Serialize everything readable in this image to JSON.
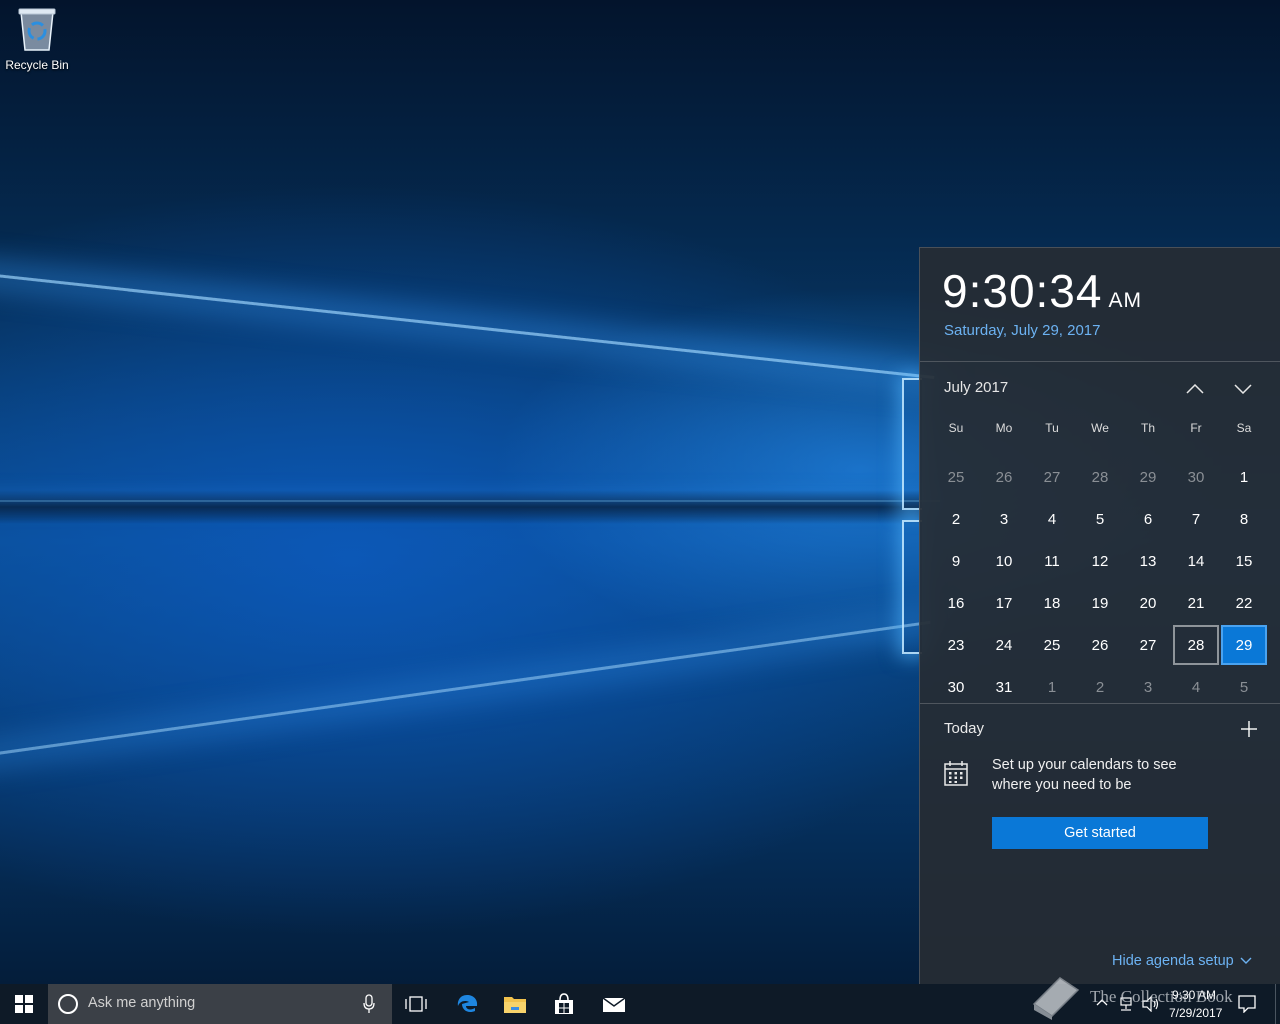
{
  "desktop": {
    "icons": [
      {
        "label": "Recycle Bin",
        "icon": "recycle-bin-icon"
      }
    ]
  },
  "flyout": {
    "time": "9:30:34",
    "ampm": "AM",
    "date": "Saturday, July 29, 2017",
    "month_title": "July 2017",
    "weekdays": [
      "Su",
      "Mo",
      "Tu",
      "We",
      "Th",
      "Fr",
      "Sa"
    ],
    "days": [
      {
        "n": "25",
        "other": true
      },
      {
        "n": "26",
        "other": true
      },
      {
        "n": "27",
        "other": true
      },
      {
        "n": "28",
        "other": true
      },
      {
        "n": "29",
        "other": true
      },
      {
        "n": "30",
        "other": true
      },
      {
        "n": "1"
      },
      {
        "n": "2"
      },
      {
        "n": "3"
      },
      {
        "n": "4"
      },
      {
        "n": "5"
      },
      {
        "n": "6"
      },
      {
        "n": "7"
      },
      {
        "n": "8"
      },
      {
        "n": "9"
      },
      {
        "n": "10"
      },
      {
        "n": "11"
      },
      {
        "n": "12"
      },
      {
        "n": "13"
      },
      {
        "n": "14"
      },
      {
        "n": "15"
      },
      {
        "n": "16"
      },
      {
        "n": "17"
      },
      {
        "n": "18"
      },
      {
        "n": "19"
      },
      {
        "n": "20"
      },
      {
        "n": "21"
      },
      {
        "n": "22"
      },
      {
        "n": "23"
      },
      {
        "n": "24"
      },
      {
        "n": "25"
      },
      {
        "n": "26"
      },
      {
        "n": "27"
      },
      {
        "n": "28",
        "selected": true
      },
      {
        "n": "29",
        "today": true
      },
      {
        "n": "30"
      },
      {
        "n": "31"
      },
      {
        "n": "1",
        "other": true
      },
      {
        "n": "2",
        "other": true
      },
      {
        "n": "3",
        "other": true
      },
      {
        "n": "4",
        "other": true
      },
      {
        "n": "5",
        "other": true
      }
    ],
    "agenda": {
      "title": "Today",
      "setup_text": "Set up your calendars to see where you need to be",
      "button_label": "Get started",
      "hide_label": "Hide agenda setup"
    }
  },
  "taskbar": {
    "search_placeholder": "Ask me anything",
    "clock_time": "9:30 AM",
    "clock_date": "7/29/2017",
    "pinned": [
      "task-view-icon",
      "edge-icon",
      "file-explorer-icon",
      "store-icon",
      "mail-icon"
    ]
  },
  "watermark": "The Collection Book",
  "colors": {
    "accent": "#0a78d7",
    "link": "#6cb2f2",
    "flyout_bg": "#262c34",
    "taskbar_bg": "#0e1a27"
  }
}
